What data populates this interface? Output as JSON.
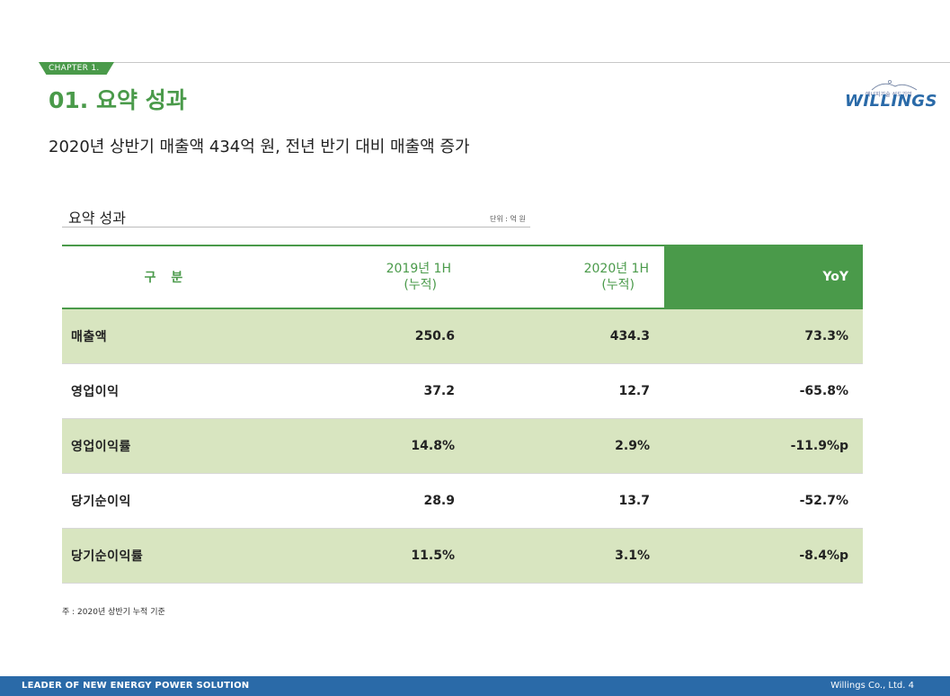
{
  "chapter": "CHAPTER 1.",
  "section_title": "01. 요약 성과",
  "logo": {
    "tagline": "에너지기술 선도기업",
    "name": "WILLINGS"
  },
  "headline": "2020년 상반기 매출액 434억 원, 전년 반기 대비 매출액 증가",
  "table": {
    "title": "요약 성과",
    "unit": "단위 : 억 원",
    "headers": {
      "label": "구 분",
      "col2019_line1": "2019년 1H",
      "col2019_line2": "(누적)",
      "col2020_line1": "2020년 1H",
      "col2020_line2": "(누적)",
      "yoy": "YoY"
    },
    "rows": [
      {
        "name": "매출액",
        "v2019": "250.6",
        "v2020": "434.3",
        "yoy": "73.3%"
      },
      {
        "name": "영업이익",
        "v2019": "37.2",
        "v2020": "12.7",
        "yoy": "-65.8%"
      },
      {
        "name": "영업이익률",
        "v2019": "14.8%",
        "v2020": "2.9%",
        "yoy": "-11.9%p"
      },
      {
        "name": "당기순이익",
        "v2019": "28.9",
        "v2020": "13.7",
        "yoy": "-52.7%"
      },
      {
        "name": "당기순이익률",
        "v2019": "11.5%",
        "v2020": "3.1%",
        "yoy": "-8.4%p"
      }
    ]
  },
  "footnote": "주 : 2020년 상반기 누적 기준",
  "footer": {
    "left": "LEADER OF NEW ENERGY POWER SOLUTION",
    "right": "Willings Co., Ltd. 4"
  },
  "colors": {
    "accent_green": "#4a9a4a",
    "row_shade": "#d8e5c0",
    "footer_blue": "#2a6aa8"
  }
}
